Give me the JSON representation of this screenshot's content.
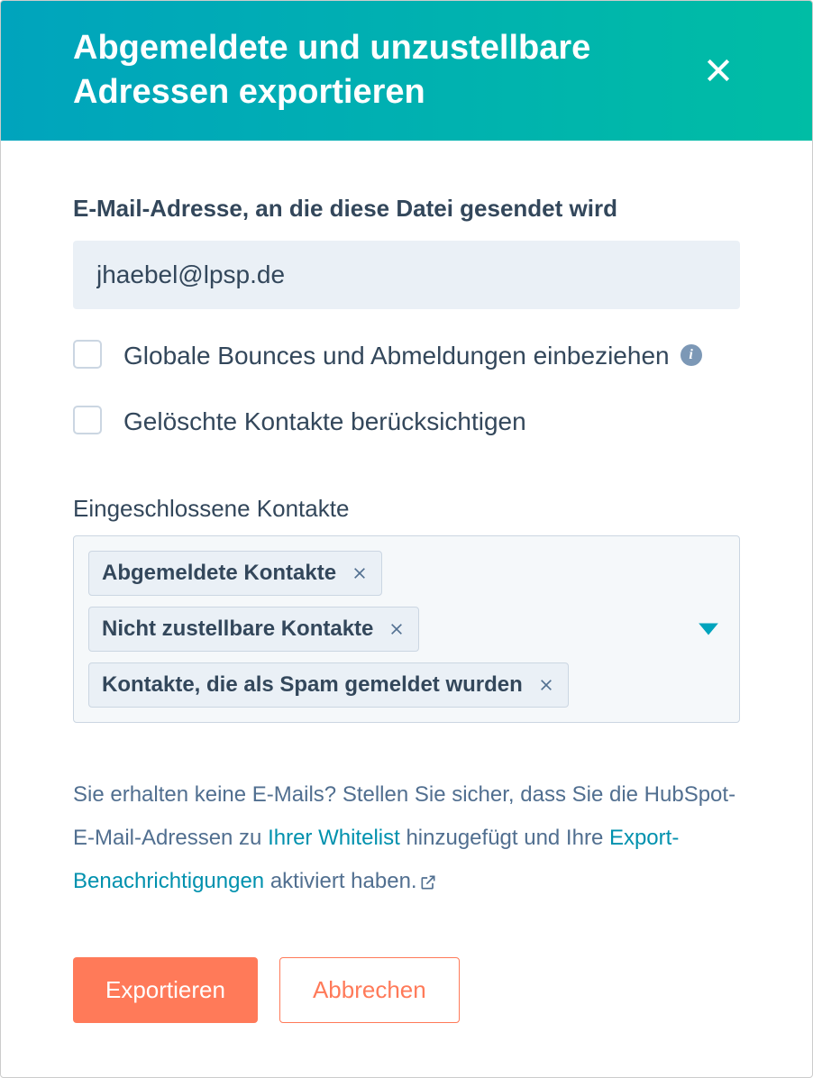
{
  "header": {
    "title": "Abgemeldete und unzustellbare Adressen exportieren"
  },
  "form": {
    "email_label": "E-Mail-Adresse, an die diese Datei gesendet wird",
    "email_value": "jhaebel@lpsp.de",
    "checkbox1_label": "Globale Bounces und Abmeldungen einbeziehen",
    "checkbox2_label": "Gelöschte Kontakte berücksichtigen",
    "included_label": "Eingeschlossene Kontakte",
    "tags": [
      "Abgemeldete Kontakte",
      "Nicht zustellbare Kontakte",
      "Kontakte, die als Spam gemeldet wurden"
    ]
  },
  "help": {
    "text1": "Sie erhalten keine E-Mails? Stellen Sie sicher, dass Sie die HubSpot-E-Mail-Adressen zu ",
    "link1": "Ihrer Whitelist",
    "text2": " hinzugefügt und Ihre ",
    "link2": "Export-Benachrichtigungen",
    "text3": " aktiviert haben."
  },
  "footer": {
    "export_label": "Exportieren",
    "cancel_label": "Abbrechen"
  }
}
